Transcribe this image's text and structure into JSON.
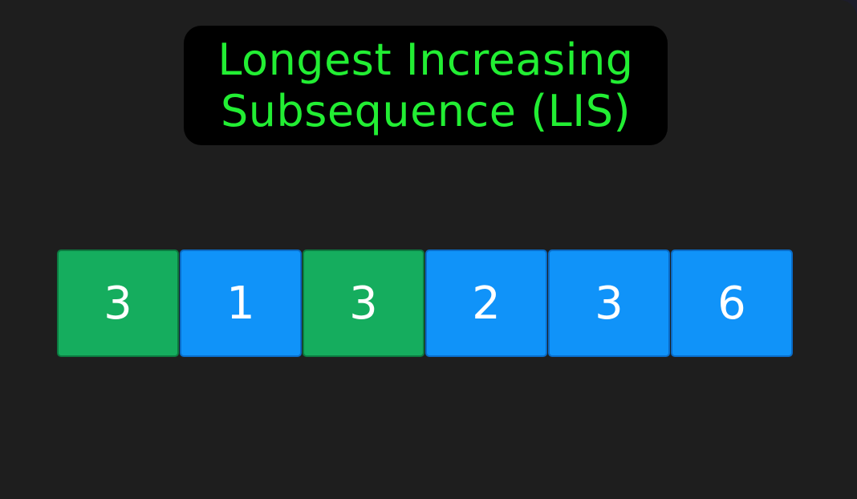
{
  "title": {
    "line1": "Longest Increasing",
    "line2": "Subsequence (LIS)"
  },
  "colors": {
    "title_text": "#22ee33",
    "highlighted_cell": "#15ad5e",
    "default_cell": "#1093f9"
  },
  "array": [
    {
      "value": "3",
      "highlighted": true
    },
    {
      "value": "1",
      "highlighted": false
    },
    {
      "value": "3",
      "highlighted": true
    },
    {
      "value": "2",
      "highlighted": false
    },
    {
      "value": "3",
      "highlighted": false
    },
    {
      "value": "6",
      "highlighted": false
    }
  ]
}
